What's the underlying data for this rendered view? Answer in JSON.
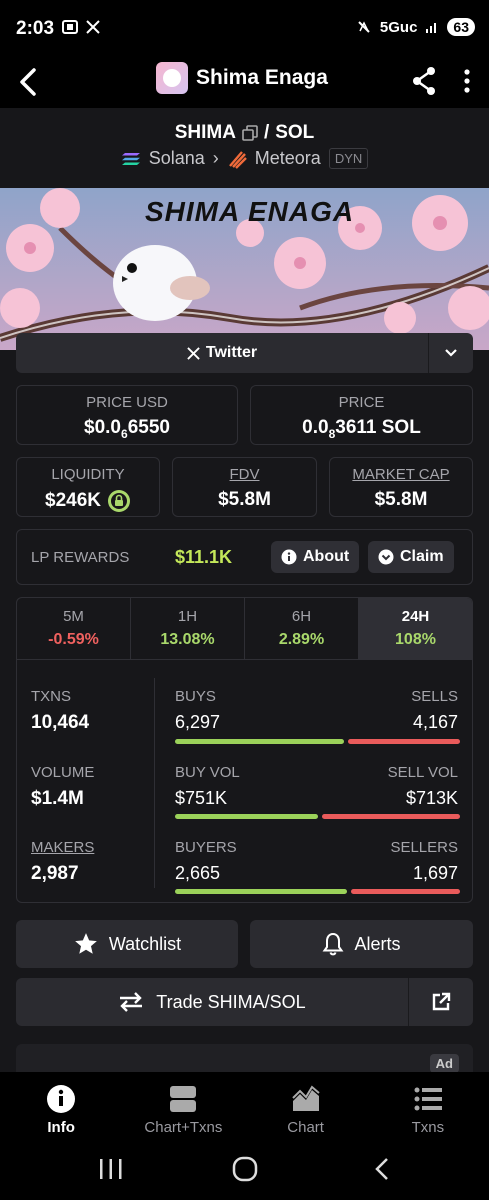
{
  "status": {
    "time": "2:03",
    "network": "5Guc",
    "battery": "63"
  },
  "header": {
    "title": "Shima Enaga"
  },
  "pair": {
    "base": "SHIMA",
    "separator": "/",
    "quote": "SOL",
    "chain": "Solana",
    "dex": "Meteora",
    "badge": "DYN"
  },
  "banner": {
    "text": "SHIMA ENAGA"
  },
  "social": {
    "twitter_label": "Twitter"
  },
  "price_usd": {
    "label": "PRICE USD",
    "prefix": "$0.0",
    "zeros": "6",
    "digits": "6550"
  },
  "price_native": {
    "label": "PRICE",
    "prefix": "0.0",
    "zeros": "8",
    "digits": "3611 SOL"
  },
  "liquidity": {
    "label": "LIQUIDITY",
    "value": "$246K"
  },
  "fdv": {
    "label": "FDV",
    "value": "$5.8M"
  },
  "market_cap": {
    "label": "MARKET CAP",
    "value": "$5.8M"
  },
  "lp_rewards": {
    "label": "LP REWARDS",
    "value": "$11.1K",
    "about_label": "About",
    "claim_label": "Claim"
  },
  "timeframes": [
    {
      "label": "5M",
      "value": "-0.59%"
    },
    {
      "label": "1H",
      "value": "13.08%"
    },
    {
      "label": "6H",
      "value": "2.89%"
    },
    {
      "label": "24H",
      "value": "108%"
    }
  ],
  "stats": {
    "txns": {
      "label": "TXNS",
      "value": "10,464"
    },
    "volume": {
      "label": "VOLUME",
      "value": "$1.4M"
    },
    "makers": {
      "label": "MAKERS",
      "value": "2,987"
    },
    "buys": {
      "label": "BUYS",
      "value": "6,297"
    },
    "sells": {
      "label": "SELLS",
      "value": "4,167"
    },
    "buy_vol": {
      "label": "BUY VOL",
      "value": "$751K"
    },
    "sell_vol": {
      "label": "SELL VOL",
      "value": "$713K"
    },
    "buyers": {
      "label": "BUYERS",
      "value": "2,665"
    },
    "sellers": {
      "label": "SELLERS",
      "value": "1,697"
    },
    "buys_ratio": 0.6,
    "vol_ratio": 0.51,
    "buyers_ratio": 0.61
  },
  "actions": {
    "watchlist": "Watchlist",
    "alerts": "Alerts",
    "trade": "Trade SHIMA/SOL"
  },
  "ad": {
    "badge": "Ad"
  },
  "nav": [
    {
      "label": "Info"
    },
    {
      "label": "Chart+Txns"
    },
    {
      "label": "Chart"
    },
    {
      "label": "Txns"
    }
  ],
  "colors": {
    "positive": "#a9d86b",
    "negative": "#f0615f",
    "lp_value": "#c4e85a"
  }
}
